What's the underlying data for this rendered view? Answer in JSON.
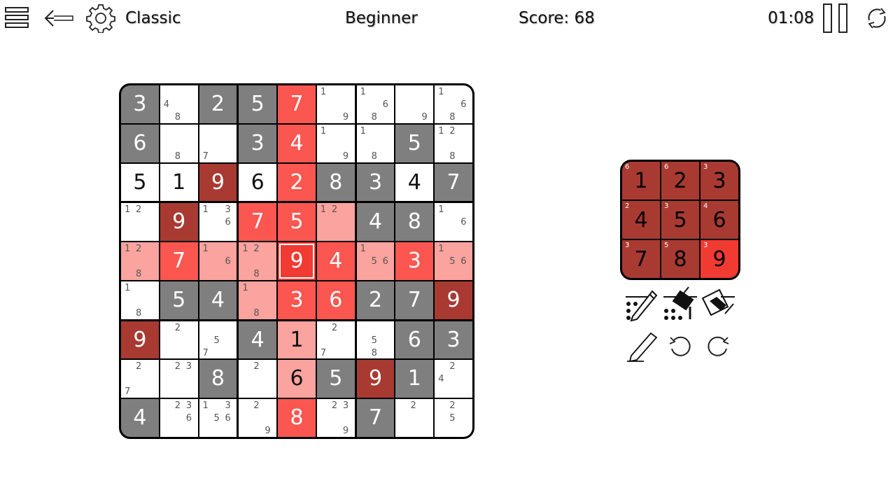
{
  "header": {
    "mode": "Classic",
    "difficulty": "Beginner",
    "score": "Score: 68",
    "timer": "01:08",
    "icons": [
      "menu-icon",
      "back-arrow-icon",
      "gear-icon",
      "pause-icon",
      "restart-icon"
    ]
  },
  "board": {
    "grid": [
      [
        {
          "v": "3",
          "bg": "g"
        },
        {
          "v": "",
          "bg": "w",
          "n": [
            4,
            8
          ]
        },
        {
          "v": "2",
          "bg": "g"
        },
        {
          "v": "5",
          "bg": "g"
        },
        {
          "v": "7",
          "bg": "r"
        },
        {
          "v": "",
          "bg": "w",
          "n": [
            1,
            9
          ]
        },
        {
          "v": "",
          "bg": "w",
          "n": [
            1,
            6,
            8
          ]
        },
        {
          "v": "",
          "bg": "w",
          "n": [
            9
          ]
        },
        {
          "v": "",
          "bg": "w",
          "n": [
            1,
            6,
            8
          ]
        }
      ],
      [
        {
          "v": "6",
          "bg": "g"
        },
        {
          "v": "",
          "bg": "w",
          "n": [
            8
          ]
        },
        {
          "v": "",
          "bg": "w",
          "n": [
            7
          ]
        },
        {
          "v": "3",
          "bg": "g"
        },
        {
          "v": "4",
          "bg": "r"
        },
        {
          "v": "",
          "bg": "w",
          "n": [
            1,
            9
          ]
        },
        {
          "v": "",
          "bg": "w",
          "n": [
            1,
            8
          ]
        },
        {
          "v": "5",
          "bg": "g"
        },
        {
          "v": "",
          "bg": "w",
          "n": [
            1,
            2,
            8
          ]
        }
      ],
      [
        {
          "v": "5",
          "bg": "w"
        },
        {
          "v": "1",
          "bg": "w"
        },
        {
          "v": "9",
          "bg": "d"
        },
        {
          "v": "6",
          "bg": "w"
        },
        {
          "v": "2",
          "bg": "r"
        },
        {
          "v": "8",
          "bg": "g"
        },
        {
          "v": "3",
          "bg": "g"
        },
        {
          "v": "4",
          "bg": "w"
        },
        {
          "v": "7",
          "bg": "g"
        }
      ],
      [
        {
          "v": "",
          "bg": "w",
          "n": [
            1,
            2
          ]
        },
        {
          "v": "9",
          "bg": "d"
        },
        {
          "v": "",
          "bg": "w",
          "n": [
            1,
            3,
            6
          ]
        },
        {
          "v": "7",
          "bg": "r"
        },
        {
          "v": "5",
          "bg": "r"
        },
        {
          "v": "",
          "bg": "p",
          "n": [
            1,
            2
          ]
        },
        {
          "v": "4",
          "bg": "g"
        },
        {
          "v": "8",
          "bg": "g"
        },
        {
          "v": "",
          "bg": "w",
          "n": [
            1,
            6
          ]
        }
      ],
      [
        {
          "v": "",
          "bg": "p",
          "n": [
            1,
            2,
            8
          ]
        },
        {
          "v": "7",
          "bg": "r"
        },
        {
          "v": "",
          "bg": "p",
          "n": [
            1,
            6
          ]
        },
        {
          "v": "",
          "bg": "p",
          "n": [
            1,
            2,
            8
          ]
        },
        {
          "v": "9",
          "bg": "s",
          "sel": true
        },
        {
          "v": "4",
          "bg": "r"
        },
        {
          "v": "",
          "bg": "p",
          "n": [
            1,
            5,
            6
          ]
        },
        {
          "v": "3",
          "bg": "r"
        },
        {
          "v": "",
          "bg": "p",
          "n": [
            1,
            5,
            6
          ]
        }
      ],
      [
        {
          "v": "",
          "bg": "w",
          "n": [
            1,
            8
          ]
        },
        {
          "v": "5",
          "bg": "g"
        },
        {
          "v": "4",
          "bg": "g"
        },
        {
          "v": "",
          "bg": "p",
          "n": [
            1,
            8
          ]
        },
        {
          "v": "3",
          "bg": "r"
        },
        {
          "v": "6",
          "bg": "r"
        },
        {
          "v": "2",
          "bg": "g"
        },
        {
          "v": "7",
          "bg": "g"
        },
        {
          "v": "9",
          "bg": "d"
        }
      ],
      [
        {
          "v": "9",
          "bg": "d"
        },
        {
          "v": "",
          "bg": "w",
          "n": [
            2
          ]
        },
        {
          "v": "",
          "bg": "w",
          "n": [
            5,
            7
          ]
        },
        {
          "v": "4",
          "bg": "g"
        },
        {
          "v": "1",
          "bg": "p"
        },
        {
          "v": "",
          "bg": "w",
          "n": [
            2,
            7
          ]
        },
        {
          "v": "",
          "bg": "w",
          "n": [
            5,
            8
          ]
        },
        {
          "v": "6",
          "bg": "g"
        },
        {
          "v": "3",
          "bg": "g"
        }
      ],
      [
        {
          "v": "",
          "bg": "w",
          "n": [
            2,
            7
          ]
        },
        {
          "v": "",
          "bg": "w",
          "n": [
            2,
            3
          ]
        },
        {
          "v": "8",
          "bg": "g"
        },
        {
          "v": "",
          "bg": "w",
          "n": [
            2
          ]
        },
        {
          "v": "6",
          "bg": "p"
        },
        {
          "v": "5",
          "bg": "g"
        },
        {
          "v": "9",
          "bg": "d"
        },
        {
          "v": "1",
          "bg": "g"
        },
        {
          "v": "",
          "bg": "w",
          "n": [
            2,
            4
          ]
        }
      ],
      [
        {
          "v": "4",
          "bg": "g"
        },
        {
          "v": "",
          "bg": "w",
          "n": [
            2,
            3,
            6
          ]
        },
        {
          "v": "",
          "bg": "w",
          "n": [
            1,
            3,
            5,
            6
          ]
        },
        {
          "v": "",
          "bg": "w",
          "n": [
            2,
            9
          ]
        },
        {
          "v": "8",
          "bg": "r"
        },
        {
          "v": "",
          "bg": "w",
          "n": [
            2,
            3,
            9
          ]
        },
        {
          "v": "7",
          "bg": "g"
        },
        {
          "v": "",
          "bg": "w",
          "n": [
            2
          ]
        },
        {
          "v": "",
          "bg": "w",
          "n": [
            2,
            5
          ]
        }
      ]
    ],
    "colors": {
      "w": {
        "bg": "#ffffff",
        "fg": "#111111"
      },
      "g": {
        "bg": "#7f7f7f",
        "fg": "#ffffff"
      },
      "r": {
        "bg": "#fb5650",
        "fg": "#ffffff"
      },
      "s": {
        "bg": "#f03a32",
        "fg": "#ffffff"
      },
      "p": {
        "bg": "#fba39e",
        "fg": "#111111"
      },
      "d": {
        "bg": "#a83a32",
        "fg": "#ffffff"
      }
    }
  },
  "numpad": {
    "keys": [
      {
        "digit": "1",
        "count": "6"
      },
      {
        "digit": "2",
        "count": "6"
      },
      {
        "digit": "3",
        "count": "3"
      },
      {
        "digit": "4",
        "count": "2"
      },
      {
        "digit": "5",
        "count": "3"
      },
      {
        "digit": "6",
        "count": "4"
      },
      {
        "digit": "7",
        "count": "3"
      },
      {
        "digit": "8",
        "count": "5"
      },
      {
        "digit": "9",
        "count": "3",
        "active": true
      }
    ]
  },
  "tools": {
    "icons": [
      "pencil-notes-icon",
      "fill-notes-icon",
      "clear-notes-icon",
      "eraser-pencil-icon",
      "undo-icon",
      "redo-icon"
    ]
  }
}
